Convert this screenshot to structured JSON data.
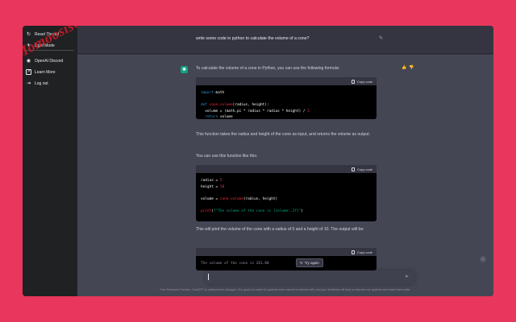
{
  "watermark": "Momoosis66",
  "sidebar": {
    "items": [
      {
        "icon": "reset-icon",
        "label": "Reset Thread"
      },
      {
        "icon": "sun-icon",
        "label": "Light Mode"
      },
      {
        "icon": "discord-icon",
        "label": "OpenAI Discord"
      },
      {
        "icon": "external-link-icon",
        "label": "Learn More"
      },
      {
        "icon": "logout-icon",
        "label": "Log out"
      }
    ]
  },
  "chat": {
    "user_message": "write some code in python to calculate the volume of a cone?",
    "assistant": {
      "intro": "To calculate the volume of a cone in Python, you can use the following formula:",
      "code1": {
        "copy_label": "Copy code",
        "lines": [
          "import math",
          "",
          "def cone_volume(radius, height):",
          "  volume = (math.pi * radius * radius * height) / 3",
          "  return volume"
        ]
      },
      "para2": "This function takes the radius and height of the cone as input, and returns the volume as output.",
      "para3": "You can use this function like this:",
      "code2": {
        "copy_label": "Copy code",
        "lines": [
          "radius = 5",
          "height = 10",
          "",
          "volume = cone_volume(radius, height)",
          "",
          "print(f\"The volume of the cone is {volume:.2f}\")"
        ]
      },
      "para4": "This will print the volume of the cone with a radius of 5 and a height of 10. The output will be:",
      "code3": {
        "copy_label": "Copy code",
        "partial_line": "The volume of the cone is 261.80"
      }
    }
  },
  "regenerate_label": "Try again",
  "input": {
    "value": "",
    "placeholder": ""
  },
  "footer": "Free Research Preview: ChatGPT is optimized for dialogue. Our goal is to make AI systems more natural to interact with, and your feedback will help us improve our systems and make them safer."
}
